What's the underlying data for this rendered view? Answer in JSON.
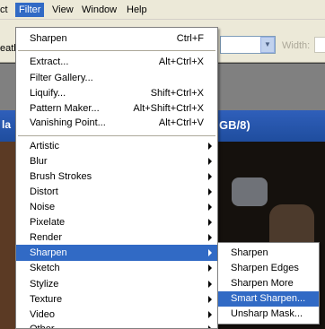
{
  "menubar": {
    "items": [
      {
        "label": "ct"
      },
      {
        "label": "Filter"
      },
      {
        "label": "View"
      },
      {
        "label": "Window"
      },
      {
        "label": "Help"
      }
    ]
  },
  "options_bar": {
    "left_partial": "eath",
    "width_label": "Width:"
  },
  "document": {
    "title_left_partial": "la",
    "title_right_partial": "GB/8)"
  },
  "filter_menu": {
    "last_filter": {
      "label": "Sharpen",
      "shortcut": "Ctrl+F"
    },
    "group2": [
      {
        "label": "Extract...",
        "shortcut": "Alt+Ctrl+X"
      },
      {
        "label": "Filter Gallery...",
        "shortcut": ""
      },
      {
        "label": "Liquify...",
        "shortcut": "Shift+Ctrl+X"
      },
      {
        "label": "Pattern Maker...",
        "shortcut": "Alt+Shift+Ctrl+X"
      },
      {
        "label": "Vanishing Point...",
        "shortcut": "Alt+Ctrl+V"
      }
    ],
    "categories": [
      {
        "label": "Artistic"
      },
      {
        "label": "Blur"
      },
      {
        "label": "Brush Strokes"
      },
      {
        "label": "Distort"
      },
      {
        "label": "Noise"
      },
      {
        "label": "Pixelate"
      },
      {
        "label": "Render"
      },
      {
        "label": "Sharpen"
      },
      {
        "label": "Sketch"
      },
      {
        "label": "Stylize"
      },
      {
        "label": "Texture"
      },
      {
        "label": "Video"
      },
      {
        "label": "Other"
      }
    ]
  },
  "sharpen_submenu": {
    "items": [
      {
        "label": "Sharpen"
      },
      {
        "label": "Sharpen Edges"
      },
      {
        "label": "Sharpen More"
      },
      {
        "label": "Smart Sharpen..."
      },
      {
        "label": "Unsharp Mask..."
      }
    ]
  },
  "colors": {
    "highlight": "#316ac5",
    "menu_bg": "#ffffff",
    "chrome_bg": "#ece9d8"
  }
}
